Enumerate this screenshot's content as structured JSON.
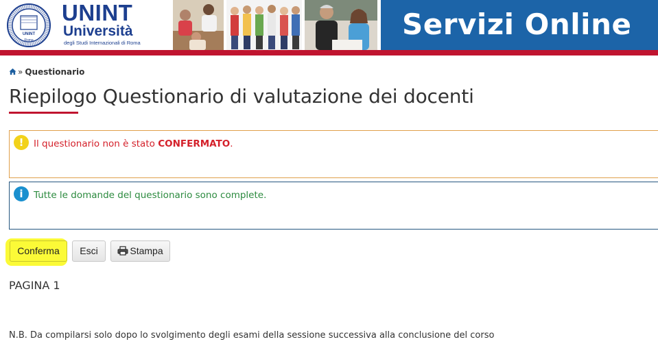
{
  "header": {
    "logo_name": "UNINT",
    "logo_subtitle": "Università",
    "logo_caption": "degli Studi Internazionali di Roma",
    "seal_ring_text": "Università degli Studi Internazionali",
    "seal_acronym": "UNINT",
    "seal_city": "Roma",
    "banner_title": "Servizi Online",
    "colors": {
      "brand_red": "#c0142f",
      "brand_blue": "#1d3f8f",
      "banner_blue": "#1c64a8"
    }
  },
  "breadcrumb": {
    "home_icon": "home-icon",
    "separator": "»",
    "current": "Questionario"
  },
  "page_title": "Riepilogo Questionario di valutazione dei docenti",
  "alerts": {
    "warning": {
      "icon": "exclamation-icon",
      "text_before": "Il questionario non è stato",
      "text_bold": "CONFERMATO",
      "text_after": "."
    },
    "info": {
      "icon": "info-icon",
      "text": "Tutte le domande del questionario sono complete."
    }
  },
  "buttons": {
    "confirm_label": "Conferma",
    "exit_label": "Esci",
    "print_label": "Stampa",
    "print_icon": "printer-icon"
  },
  "page_label": "PAGINA 1",
  "note": "N.B. Da compilarsi solo dopo lo svolgimento degli esami della sessione successiva alla conclusione del corso"
}
